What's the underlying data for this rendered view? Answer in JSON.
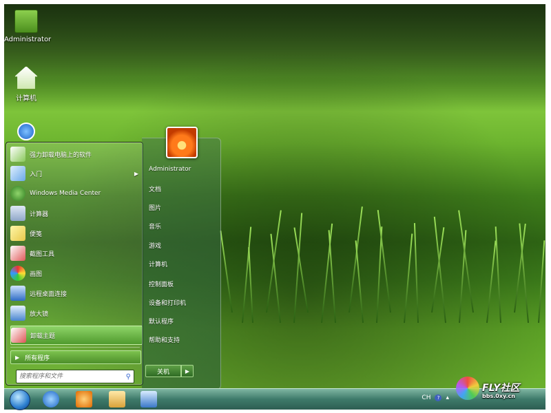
{
  "desktop": {
    "icons": [
      {
        "label": "Administrator",
        "icon": "folder-star-icon"
      },
      {
        "label": "计算机",
        "icon": "home-computer-icon"
      },
      {
        "label": "",
        "icon": "network-globe-icon"
      }
    ]
  },
  "start_menu": {
    "programs": [
      {
        "label": "强力卸载电脑上的软件",
        "icon": "uninstall-software-icon"
      },
      {
        "label": "入门",
        "icon": "getting-started-icon",
        "has_submenu": true
      },
      {
        "label": "Windows Media Center",
        "icon": "media-center-icon"
      },
      {
        "label": "计算器",
        "icon": "calculator-icon"
      },
      {
        "label": "便笺",
        "icon": "sticky-notes-icon"
      },
      {
        "label": "截图工具",
        "icon": "snipping-tool-icon"
      },
      {
        "label": "画图",
        "icon": "paint-icon"
      },
      {
        "label": "远程桌面连接",
        "icon": "remote-desktop-icon"
      },
      {
        "label": "放大镜",
        "icon": "magnifier-icon"
      },
      {
        "label": "卸载主题",
        "icon": "uninstall-theme-icon",
        "highlighted": true
      }
    ],
    "all_programs_label": "所有程序",
    "search": {
      "placeholder": "搜索程序和文件"
    },
    "right_items": [
      "Administrator",
      "文档",
      "图片",
      "音乐",
      "游戏",
      "计算机",
      "控制面板",
      "设备和打印机",
      "默认程序",
      "帮助和支持"
    ],
    "shutdown_label": "关机"
  },
  "taskbar": {
    "pinned": [
      "internet-explorer-icon",
      "media-player-icon",
      "explorer-folder-icon",
      "control-panel-icon"
    ],
    "tray": {
      "language": "CH",
      "help_glyph": "?"
    }
  },
  "watermark": {
    "brand": "FLY社区",
    "url": "bbs.0xy.cn"
  },
  "colors": {
    "accent_green": "#4f9a2d",
    "taskbar": "#3e7a6a"
  }
}
